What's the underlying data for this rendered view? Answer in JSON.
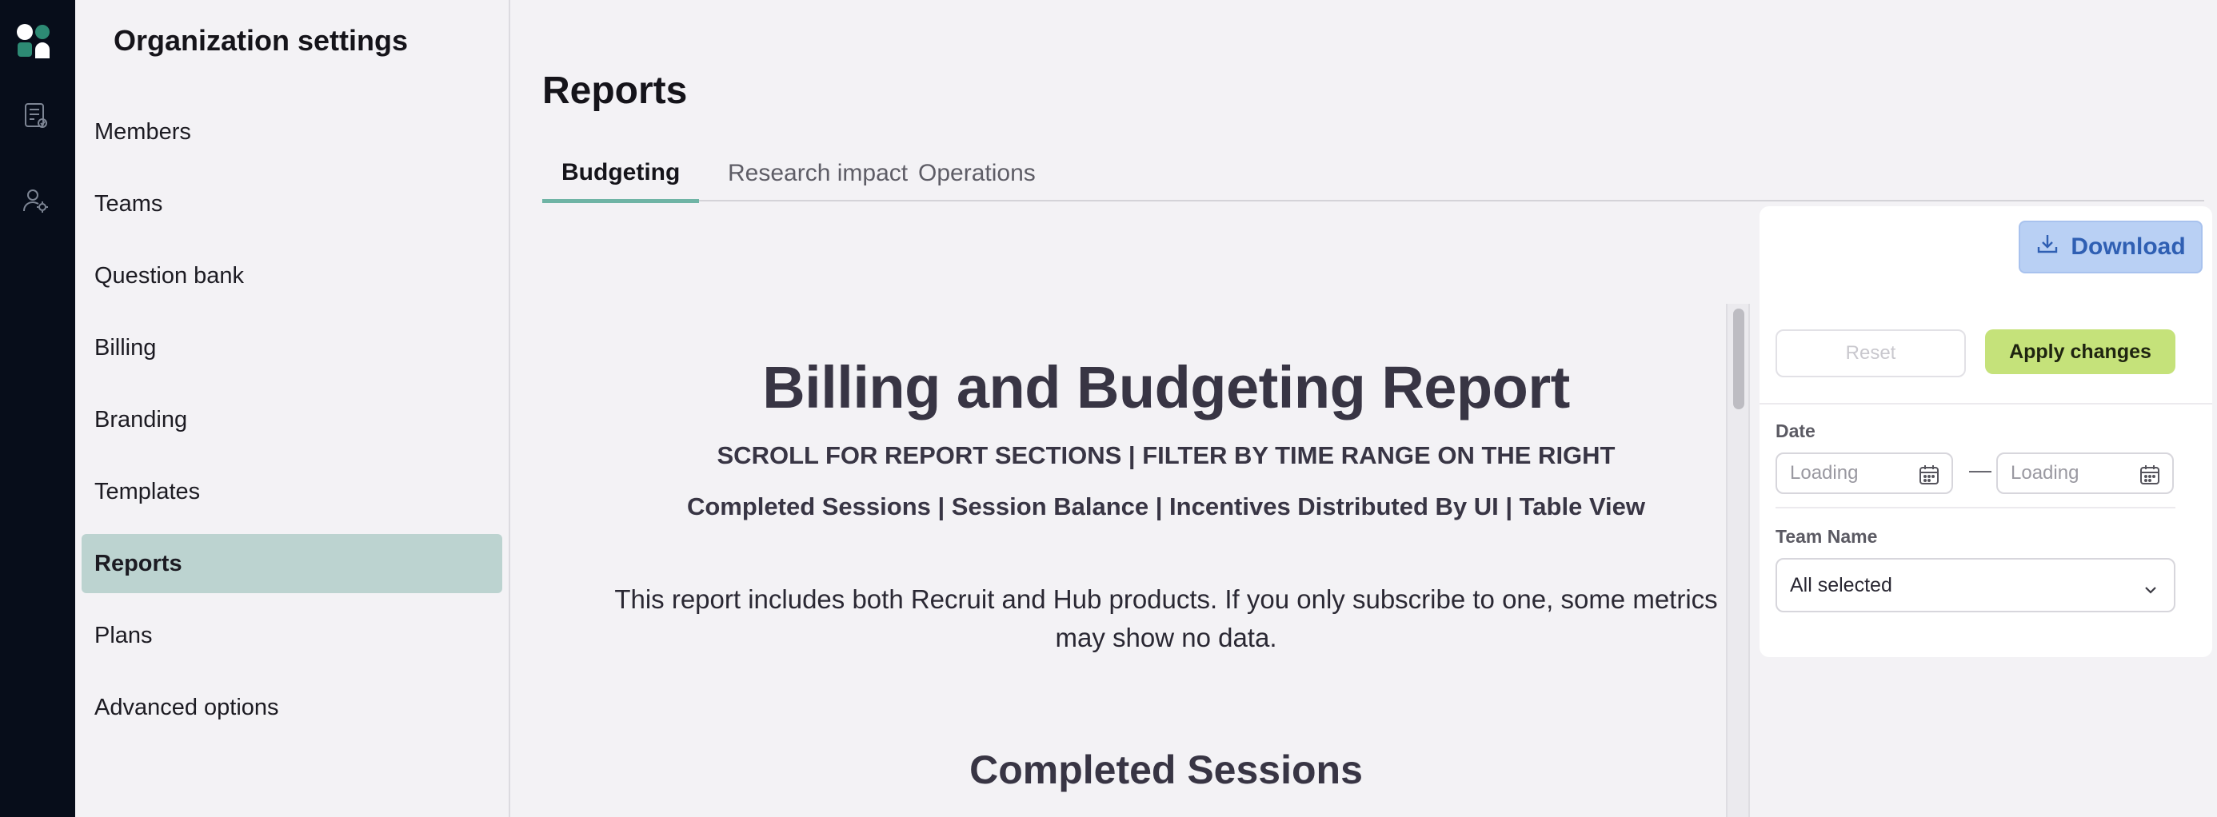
{
  "rail": {
    "icons": [
      "logo-icon",
      "report-icon",
      "user-settings-icon"
    ]
  },
  "sidebar": {
    "title": "Organization settings",
    "items": [
      {
        "label": "Members"
      },
      {
        "label": "Teams"
      },
      {
        "label": "Question bank"
      },
      {
        "label": "Billing"
      },
      {
        "label": "Branding"
      },
      {
        "label": "Templates"
      },
      {
        "label": "Reports",
        "active": true
      },
      {
        "label": "Plans"
      },
      {
        "label": "Advanced options"
      }
    ]
  },
  "main": {
    "title": "Reports",
    "tabs": [
      {
        "label": "Budgeting",
        "active": true
      },
      {
        "label": "Research impact"
      },
      {
        "label": "Operations"
      }
    ]
  },
  "report": {
    "title": "Billing and Budgeting Report",
    "subtitle1": "SCROLL FOR REPORT SECTIONS | FILTER BY TIME RANGE ON THE RIGHT",
    "subtitle2": "Completed Sessions | Session Balance | Incentives Distributed By UI | Table View",
    "note": "This report includes both Recruit and Hub products. If you only subscribe to one, some metrics may show no data.",
    "section_heading": "Completed Sessions"
  },
  "filters": {
    "download_label": "Download",
    "reset_label": "Reset",
    "apply_label": "Apply changes",
    "date_label": "Date",
    "date_from_placeholder": "Loading",
    "date_to_placeholder": "Loading",
    "date_separator": "—",
    "team_label": "Team Name",
    "team_value": "All selected"
  },
  "colors": {
    "rail_bg": "#070d1a",
    "active_nav_bg": "#bcd3d0",
    "tab_indicator": "#6fb4a5",
    "download_bg": "#b9d0f4",
    "apply_bg": "#c5e27a",
    "logo_teal": "#2d8a74"
  }
}
